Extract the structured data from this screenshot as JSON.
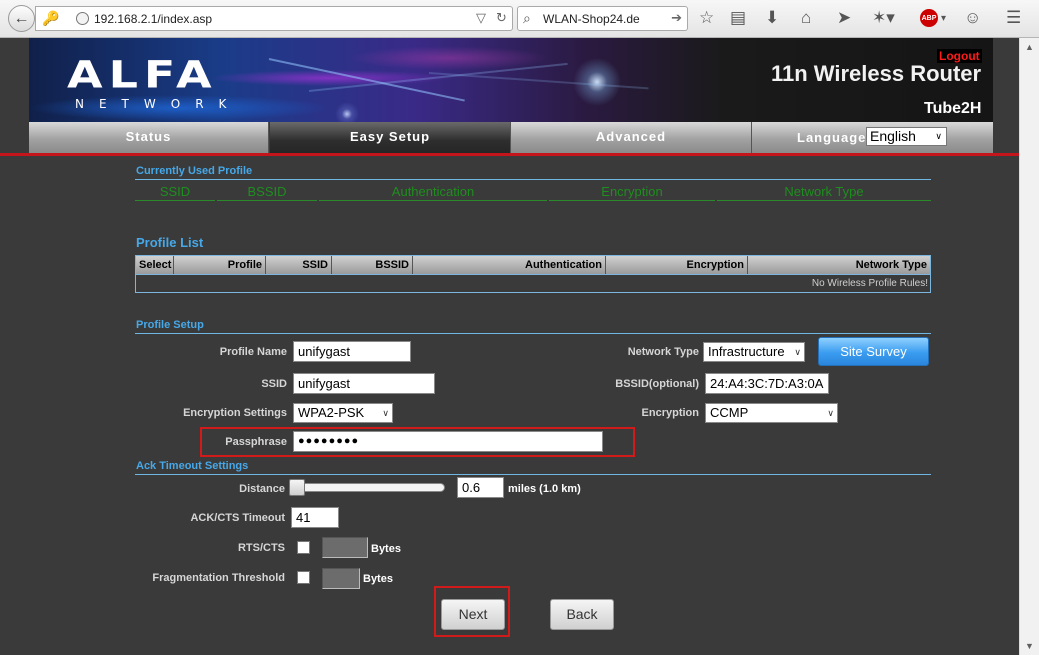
{
  "browser": {
    "url": "192.168.2.1/index.asp",
    "search_engine": "WLAN-Shop24.de",
    "toolbar_icons": [
      "back-icon",
      "key-icon",
      "globe-icon",
      "dropdown-icon",
      "reload-icon",
      "search-icon",
      "go-icon",
      "star-icon",
      "reading-list-icon",
      "download-icon",
      "home-icon",
      "share-icon",
      "network-icon",
      "adblock-icon",
      "smiley-icon",
      "menu-icon"
    ],
    "adblock_label": "ABP"
  },
  "header": {
    "logo_text": "ALFA",
    "logo_sub": "NETWORK",
    "logout": "Logout",
    "product_title": "11n Wireless Router",
    "model": "Tube2H"
  },
  "tabs": [
    {
      "label": "Status",
      "active": false
    },
    {
      "label": "Easy Setup",
      "active": true
    },
    {
      "label": "Advanced",
      "active": false
    }
  ],
  "language": {
    "label": "Language",
    "value": "English"
  },
  "current_profile": {
    "title": "Currently Used Profile",
    "columns": [
      "SSID",
      "BSSID",
      "Authentication",
      "Encryption",
      "Network Type"
    ]
  },
  "profile_list": {
    "title": "Profile List",
    "columns": [
      "Select",
      "Profile",
      "SSID",
      "BSSID",
      "Authentication",
      "Encryption",
      "Network Type"
    ],
    "empty_text": "No Wireless Profile Rules!"
  },
  "profile_setup": {
    "title": "Profile Setup",
    "profile_name_label": "Profile Name",
    "profile_name": "unifygast",
    "ssid_label": "SSID",
    "ssid": "unifygast",
    "encryption_settings_label": "Encryption Settings",
    "encryption_settings": "WPA2-PSK",
    "passphrase_label": "Passphrase",
    "passphrase": "●●●●●●●●",
    "network_type_label": "Network Type",
    "network_type": "Infrastructure",
    "site_survey": "Site Survey",
    "bssid_label": "BSSID(optional)",
    "bssid": "24:A4:3C:7D:A3:0A",
    "encryption_label": "Encryption",
    "encryption": "CCMP"
  },
  "ack_timeout": {
    "title": "Ack Timeout Settings",
    "distance_label": "Distance",
    "distance_value": "0.6",
    "distance_unit": "miles (1.0 km)",
    "slider_fraction": 0.0,
    "ack_cts_label": "ACK/CTS Timeout",
    "ack_cts_value": "41",
    "rts_cts_label": "RTS/CTS",
    "rts_cts_unit": "Bytes",
    "frag_label": "Fragmentation Threshold",
    "frag_unit": "Bytes"
  },
  "buttons": {
    "next": "Next",
    "back": "Back"
  },
  "colors": {
    "accent_red": "#c4151c",
    "section_blue": "#46a8e8",
    "header_green": "#1e8e1e"
  }
}
